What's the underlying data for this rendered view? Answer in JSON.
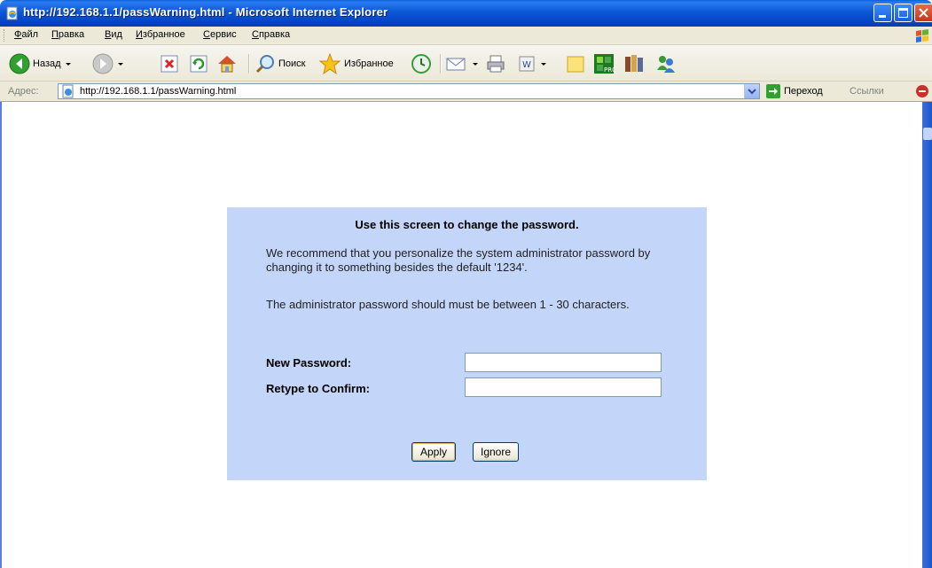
{
  "window": {
    "title": "http://192.168.1.1/passWarning.html - Microsoft Internet Explorer"
  },
  "menu": {
    "items": [
      "Файл",
      "Правка",
      "Вид",
      "Избранное",
      "Сервис",
      "Справка"
    ]
  },
  "toolbar": {
    "back_label": "Назад",
    "search_label": "Поиск",
    "favorites_label": "Избранное"
  },
  "address": {
    "label": "Адрес:",
    "url": "http://192.168.1.1/passWarning.html",
    "go_label": "Переход",
    "links_label": "Ссылки"
  },
  "page": {
    "heading": "Use this screen to change the password.",
    "paragraph1": "We recommend that you personalize the system administrator password by changing it to something besides the default '1234'.",
    "paragraph2": "The administrator password should must be between 1 - 30 characters.",
    "new_password_label": "New Password:",
    "new_password_value": "",
    "confirm_label": "Retype to Confirm:",
    "confirm_value": "",
    "apply_label": "Apply",
    "ignore_label": "Ignore"
  },
  "colors": {
    "panel_bg": "#c3d5f9",
    "titlebar": "#0b58d6",
    "chrome": "#ece9d8"
  }
}
